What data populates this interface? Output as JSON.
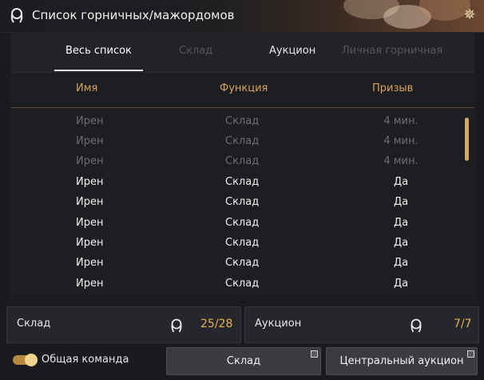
{
  "window": {
    "title": "Список горничных/мажордомов",
    "icon": "maid-icon",
    "corner_icon": "gear-star-icon"
  },
  "tabs": [
    {
      "label": "Весь список",
      "state": "active"
    },
    {
      "label": "Склад",
      "state": "disabled"
    },
    {
      "label": "Аукцион",
      "state": "normal"
    },
    {
      "label": "Личная горничная",
      "state": "disabled"
    }
  ],
  "table": {
    "columns": [
      "Имя",
      "Функция",
      "Призыв"
    ],
    "rows": [
      {
        "name": "Ирен",
        "function": "Склад",
        "call": "4 мин.",
        "available": false
      },
      {
        "name": "Ирен",
        "function": "Склад",
        "call": "4 мин.",
        "available": false
      },
      {
        "name": "Ирен",
        "function": "Склад",
        "call": "4 мин.",
        "available": false
      },
      {
        "name": "Ирен",
        "function": "Склад",
        "call": "Да",
        "available": true
      },
      {
        "name": "Ирен",
        "function": "Склад",
        "call": "Да",
        "available": true
      },
      {
        "name": "Ирен",
        "function": "Склад",
        "call": "Да",
        "available": true
      },
      {
        "name": "Ирен",
        "function": "Склад",
        "call": "Да",
        "available": true
      },
      {
        "name": "Ирен",
        "function": "Склад",
        "call": "Да",
        "available": true
      },
      {
        "name": "Ирен",
        "function": "Склад",
        "call": "Да",
        "available": true
      }
    ]
  },
  "summary": {
    "warehouse": {
      "label": "Склад",
      "count": "25/28"
    },
    "auction": {
      "label": "Аукцион",
      "count": "7/7"
    }
  },
  "footer": {
    "toggle_label": "Общая команда",
    "toggle_on": true,
    "warehouse_button": "Склад",
    "auction_button": "Центральный аукцион"
  },
  "colors": {
    "accent": "#d6a35a",
    "count": "#e7b34f",
    "dim": "#6d6e72"
  }
}
